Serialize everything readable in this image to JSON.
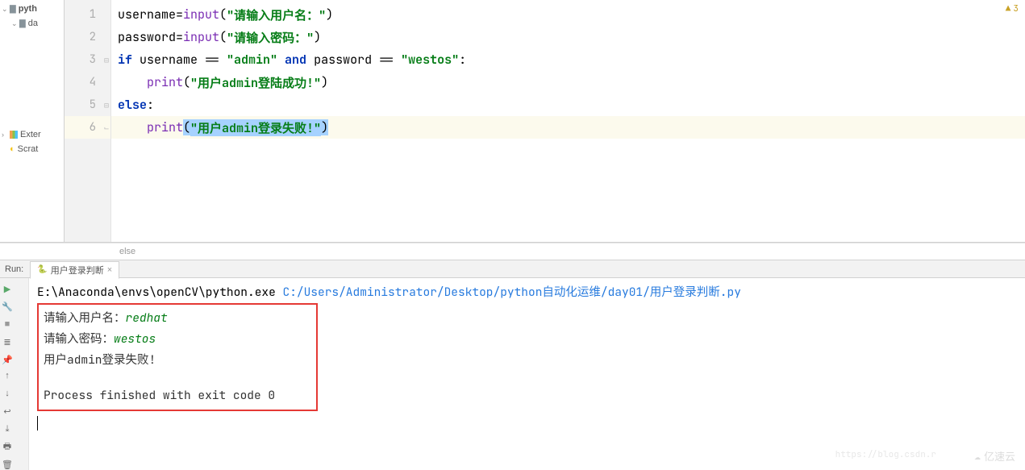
{
  "sidebar": {
    "root": "pyth",
    "child": "da",
    "ext_libs": "Exter",
    "scratches": "Scrat"
  },
  "gutter": {
    "lines": [
      "1",
      "2",
      "3",
      "4",
      "5",
      "6"
    ]
  },
  "code": {
    "l1_var": "username",
    "l1_eq": "=",
    "l1_fn": "input",
    "l1_p": "(",
    "l1_str": "\"请输入用户名：\"",
    "l1_cp": ")",
    "l2_var": "password",
    "l2_eq": "=",
    "l2_fn": "input",
    "l2_p": "(",
    "l2_str": "\"请输入密码：\"",
    "l2_cp": ")",
    "l3_if": "if ",
    "l3_a": "username == ",
    "l3_s1": "\"admin\"",
    "l3_and": " and ",
    "l3_b": "password == ",
    "l3_s2": "\"westos\"",
    "l3_c": ":",
    "l4_fn": "print",
    "l4_p": "(",
    "l4_str": "\"用户admin登陆成功!\"",
    "l4_cp": ")",
    "l5_else": "else",
    "l5_c": ":",
    "l6_fn": "print",
    "l6_p": "(",
    "l6_str": "\"用户admin登录失败!\"",
    "l6_cp": ")"
  },
  "warnings": {
    "count": "3"
  },
  "breadcrumb": {
    "current": "else"
  },
  "run": {
    "label": "Run:",
    "tab": "用户登录判断",
    "cmd_prefix": "E:\\Anaconda\\envs\\openCV\\python.exe ",
    "cmd_arg": "C:/Users/Administrator/Desktop/python自动化运维/day01/用户登录判断.py",
    "out1_prompt": "请输入用户名：",
    "out1_input": "redhat",
    "out2_prompt": "请输入密码：",
    "out2_input": "westos",
    "out3": "用户admin登录失败!",
    "exit": "Process finished with exit code 0"
  },
  "watermark": {
    "url": "https://blog.csdn.r",
    "brand": "亿速云"
  }
}
